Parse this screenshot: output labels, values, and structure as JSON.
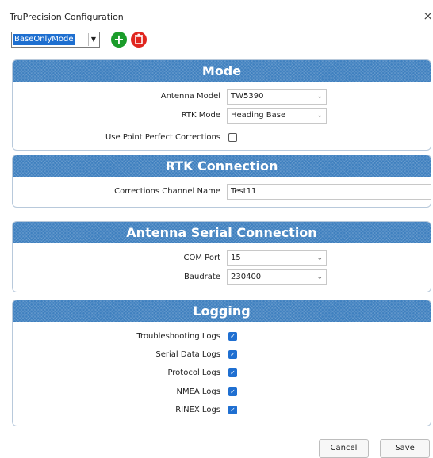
{
  "window": {
    "title": "TruPrecision Configuration",
    "close_glyph": "×"
  },
  "toolbar": {
    "mode_value": "BaseOnlyMode",
    "add_icon": "plus-circle-icon",
    "delete_icon": "trash-icon"
  },
  "mode_panel": {
    "header": "Mode",
    "antenna_model_label": "Antenna Model",
    "antenna_model_value": "TW5390",
    "rtk_mode_label": "RTK Mode",
    "rtk_mode_value": "Heading Base",
    "ppp_label": "Use Point Perfect Corrections",
    "ppp_checked": false
  },
  "rtk_panel": {
    "header": "RTK Connection",
    "channel_label": "Corrections Channel Name",
    "channel_value": "Test11"
  },
  "serial_panel": {
    "header": "Antenna Serial Connection",
    "com_port_label": "COM Port",
    "com_port_value": "15",
    "baudrate_label": "Baudrate",
    "baudrate_value": "230400"
  },
  "logging_panel": {
    "header": "Logging",
    "items": [
      {
        "label": "Troubleshooting Logs",
        "checked": true
      },
      {
        "label": "Serial Data Logs",
        "checked": true
      },
      {
        "label": "Protocol Logs",
        "checked": true
      },
      {
        "label": "NMEA Logs",
        "checked": true
      },
      {
        "label": "RINEX Logs",
        "checked": true
      }
    ]
  },
  "footer": {
    "cancel_label": "Cancel",
    "save_label": "Save"
  },
  "colors": {
    "header_blue": "#3f80bf",
    "check_blue": "#1f6fd1",
    "add_green": "#1a9c2a",
    "delete_red": "#e0261f"
  }
}
